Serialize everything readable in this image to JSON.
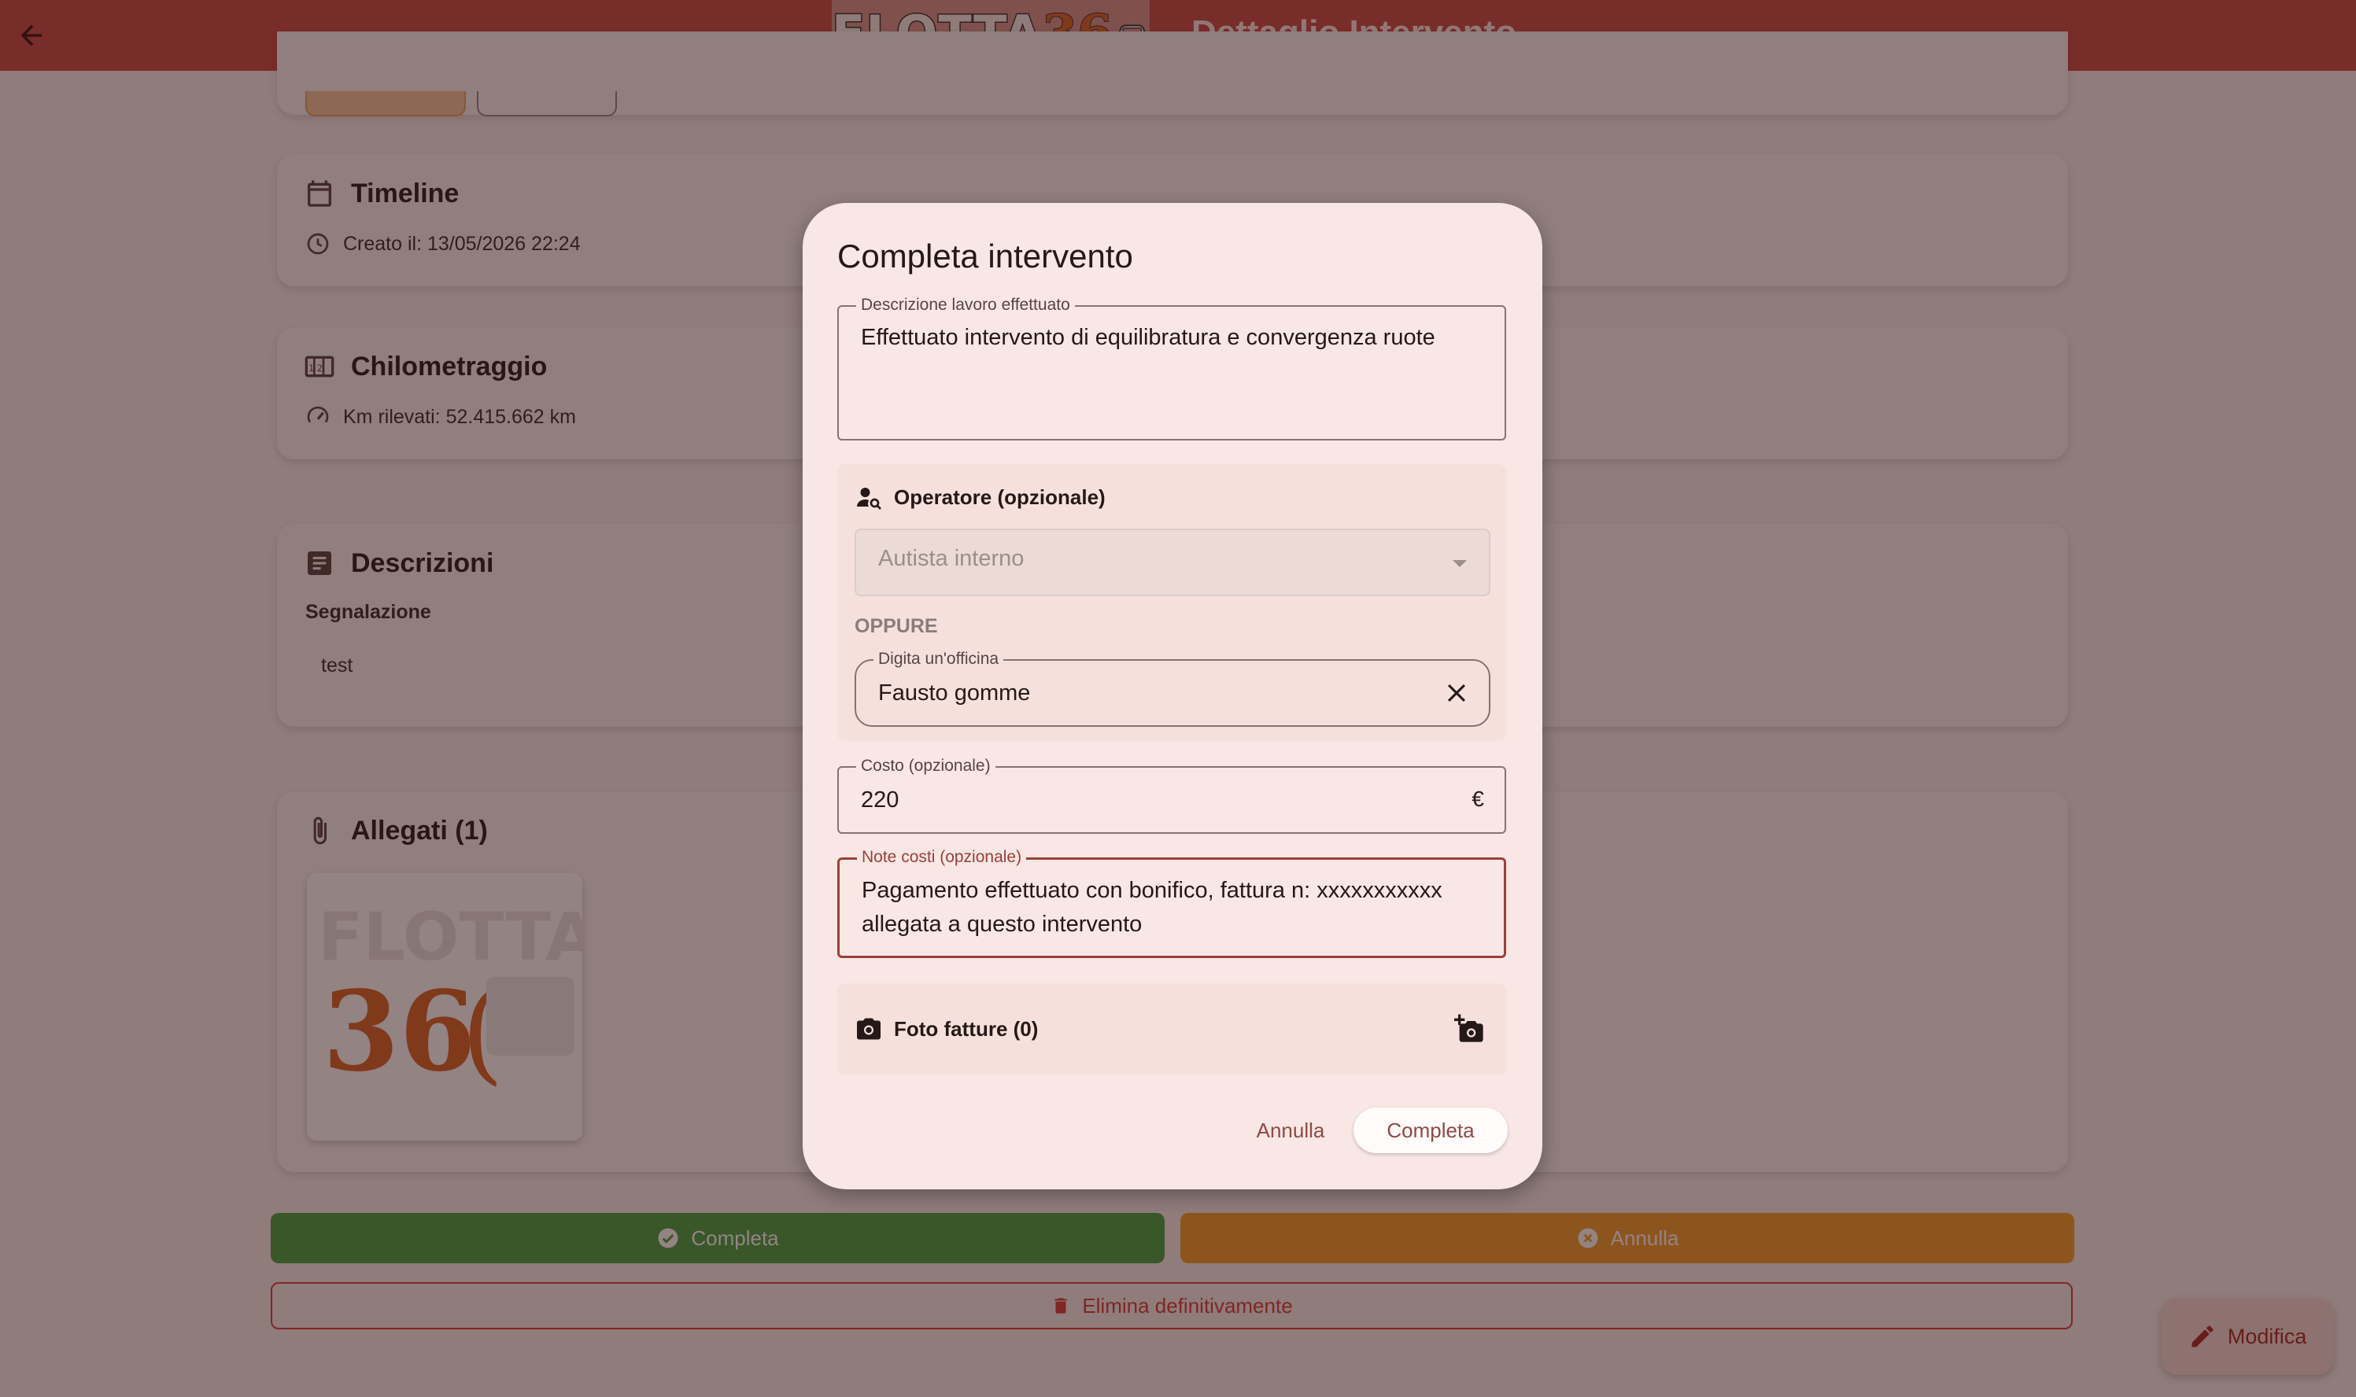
{
  "appbar": {
    "title": "Dettaglio Intervento",
    "logo_text": "FLOTTA",
    "logo_number": "36"
  },
  "colors": {
    "primary": "#c8524c",
    "success": "#4ba64a",
    "warning": "#f2a334",
    "danger": "#d9453f",
    "scrim": "#280808"
  },
  "timeline": {
    "title": "Timeline",
    "created": "Creato il: 13/05/2026 22:24"
  },
  "mileage": {
    "title": "Chilometraggio",
    "km": "Km rilevati: 52.415.662 km"
  },
  "descriptions": {
    "title": "Descrizioni",
    "label": "Segnalazione",
    "value": "test"
  },
  "attachments": {
    "title": "Allegati (1)"
  },
  "actions": {
    "complete": "Completa",
    "cancel": "Annulla",
    "delete": "Elimina definitivamente",
    "edit": "Modifica"
  },
  "dialog": {
    "title": "Completa intervento",
    "work_description": {
      "label": "Descrizione lavoro effettuato",
      "value": "Effettuato intervento di equilibratura e convergenza ruote"
    },
    "operator": {
      "title": "Operatore (opzionale)",
      "select_value": "Autista interno",
      "or_label": "OPPURE",
      "workshop_label": "Digita un'officina",
      "workshop_value": "Fausto gomme"
    },
    "cost": {
      "label": "Costo (opzionale)",
      "value": "220",
      "suffix": "€"
    },
    "cost_notes": {
      "label": "Note costi (opzionale)",
      "line1": "Pagamento effettuato con bonifico, fattura n: xxxxxxxxxxx",
      "line2": "allegata a questo intervento"
    },
    "invoice_photos": {
      "title": "Foto fatture (0)"
    },
    "cancel_label": "Annulla",
    "confirm_label": "Completa"
  }
}
